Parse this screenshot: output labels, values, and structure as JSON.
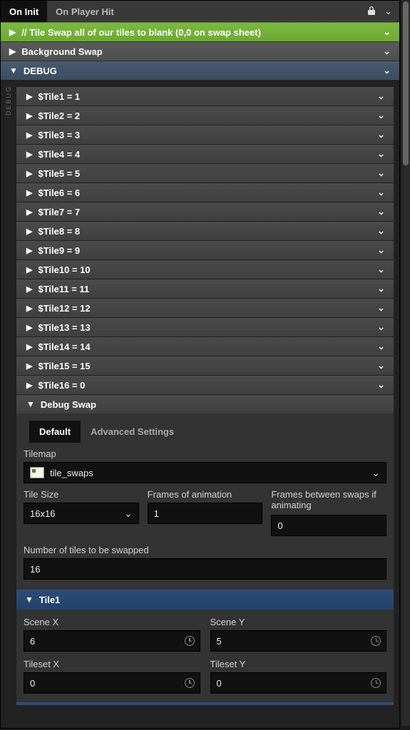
{
  "tabs": {
    "active": "On Init",
    "items": [
      "On Init",
      "On Player Hit"
    ]
  },
  "sections": {
    "comment": {
      "label": "// Tile Swap all of our tiles to blank (0,0 on swap sheet)"
    },
    "bg": {
      "label": "Background Swap"
    },
    "debug": {
      "label": "DEBUG"
    }
  },
  "tiles": [
    {
      "label": "$Tile1 = 1"
    },
    {
      "label": "$Tile2 = 2"
    },
    {
      "label": "$Tile3 = 3"
    },
    {
      "label": "$Tile4 = 4"
    },
    {
      "label": "$Tile5 = 5"
    },
    {
      "label": "$Tile6 = 6"
    },
    {
      "label": "$Tile7 = 7"
    },
    {
      "label": "$Tile8 = 8"
    },
    {
      "label": "$Tile9 = 9"
    },
    {
      "label": "$Tile10 = 10"
    },
    {
      "label": "$Tile11 = 11"
    },
    {
      "label": "$Tile12 = 12"
    },
    {
      "label": "$Tile13 = 13"
    },
    {
      "label": "$Tile14 = 14"
    },
    {
      "label": "$Tile15 = 15"
    },
    {
      "label": "$Tile16 = 0"
    }
  ],
  "swap": {
    "header": "Debug Swap",
    "modes": {
      "default": "Default",
      "advanced": "Advanced Settings"
    },
    "tilemap_label": "Tilemap",
    "tilemap_value": "tile_swaps",
    "tilesize_label": "Tile Size",
    "tilesize_value": "16x16",
    "frames_label": "Frames of animation",
    "frames_value": "1",
    "between_label": "Frames between swaps if animating",
    "between_value": "0",
    "count_label": "Number of tiles to be swapped",
    "count_value": "16",
    "tile1_label": "Tile1",
    "fields": {
      "sx_label": "Scene X",
      "sx_value": "6",
      "sy_label": "Scene Y",
      "sy_value": "5",
      "tx_label": "Tileset X",
      "tx_value": "0",
      "ty_label": "Tileset Y",
      "ty_value": "0"
    }
  },
  "side_label": "DEBUG"
}
